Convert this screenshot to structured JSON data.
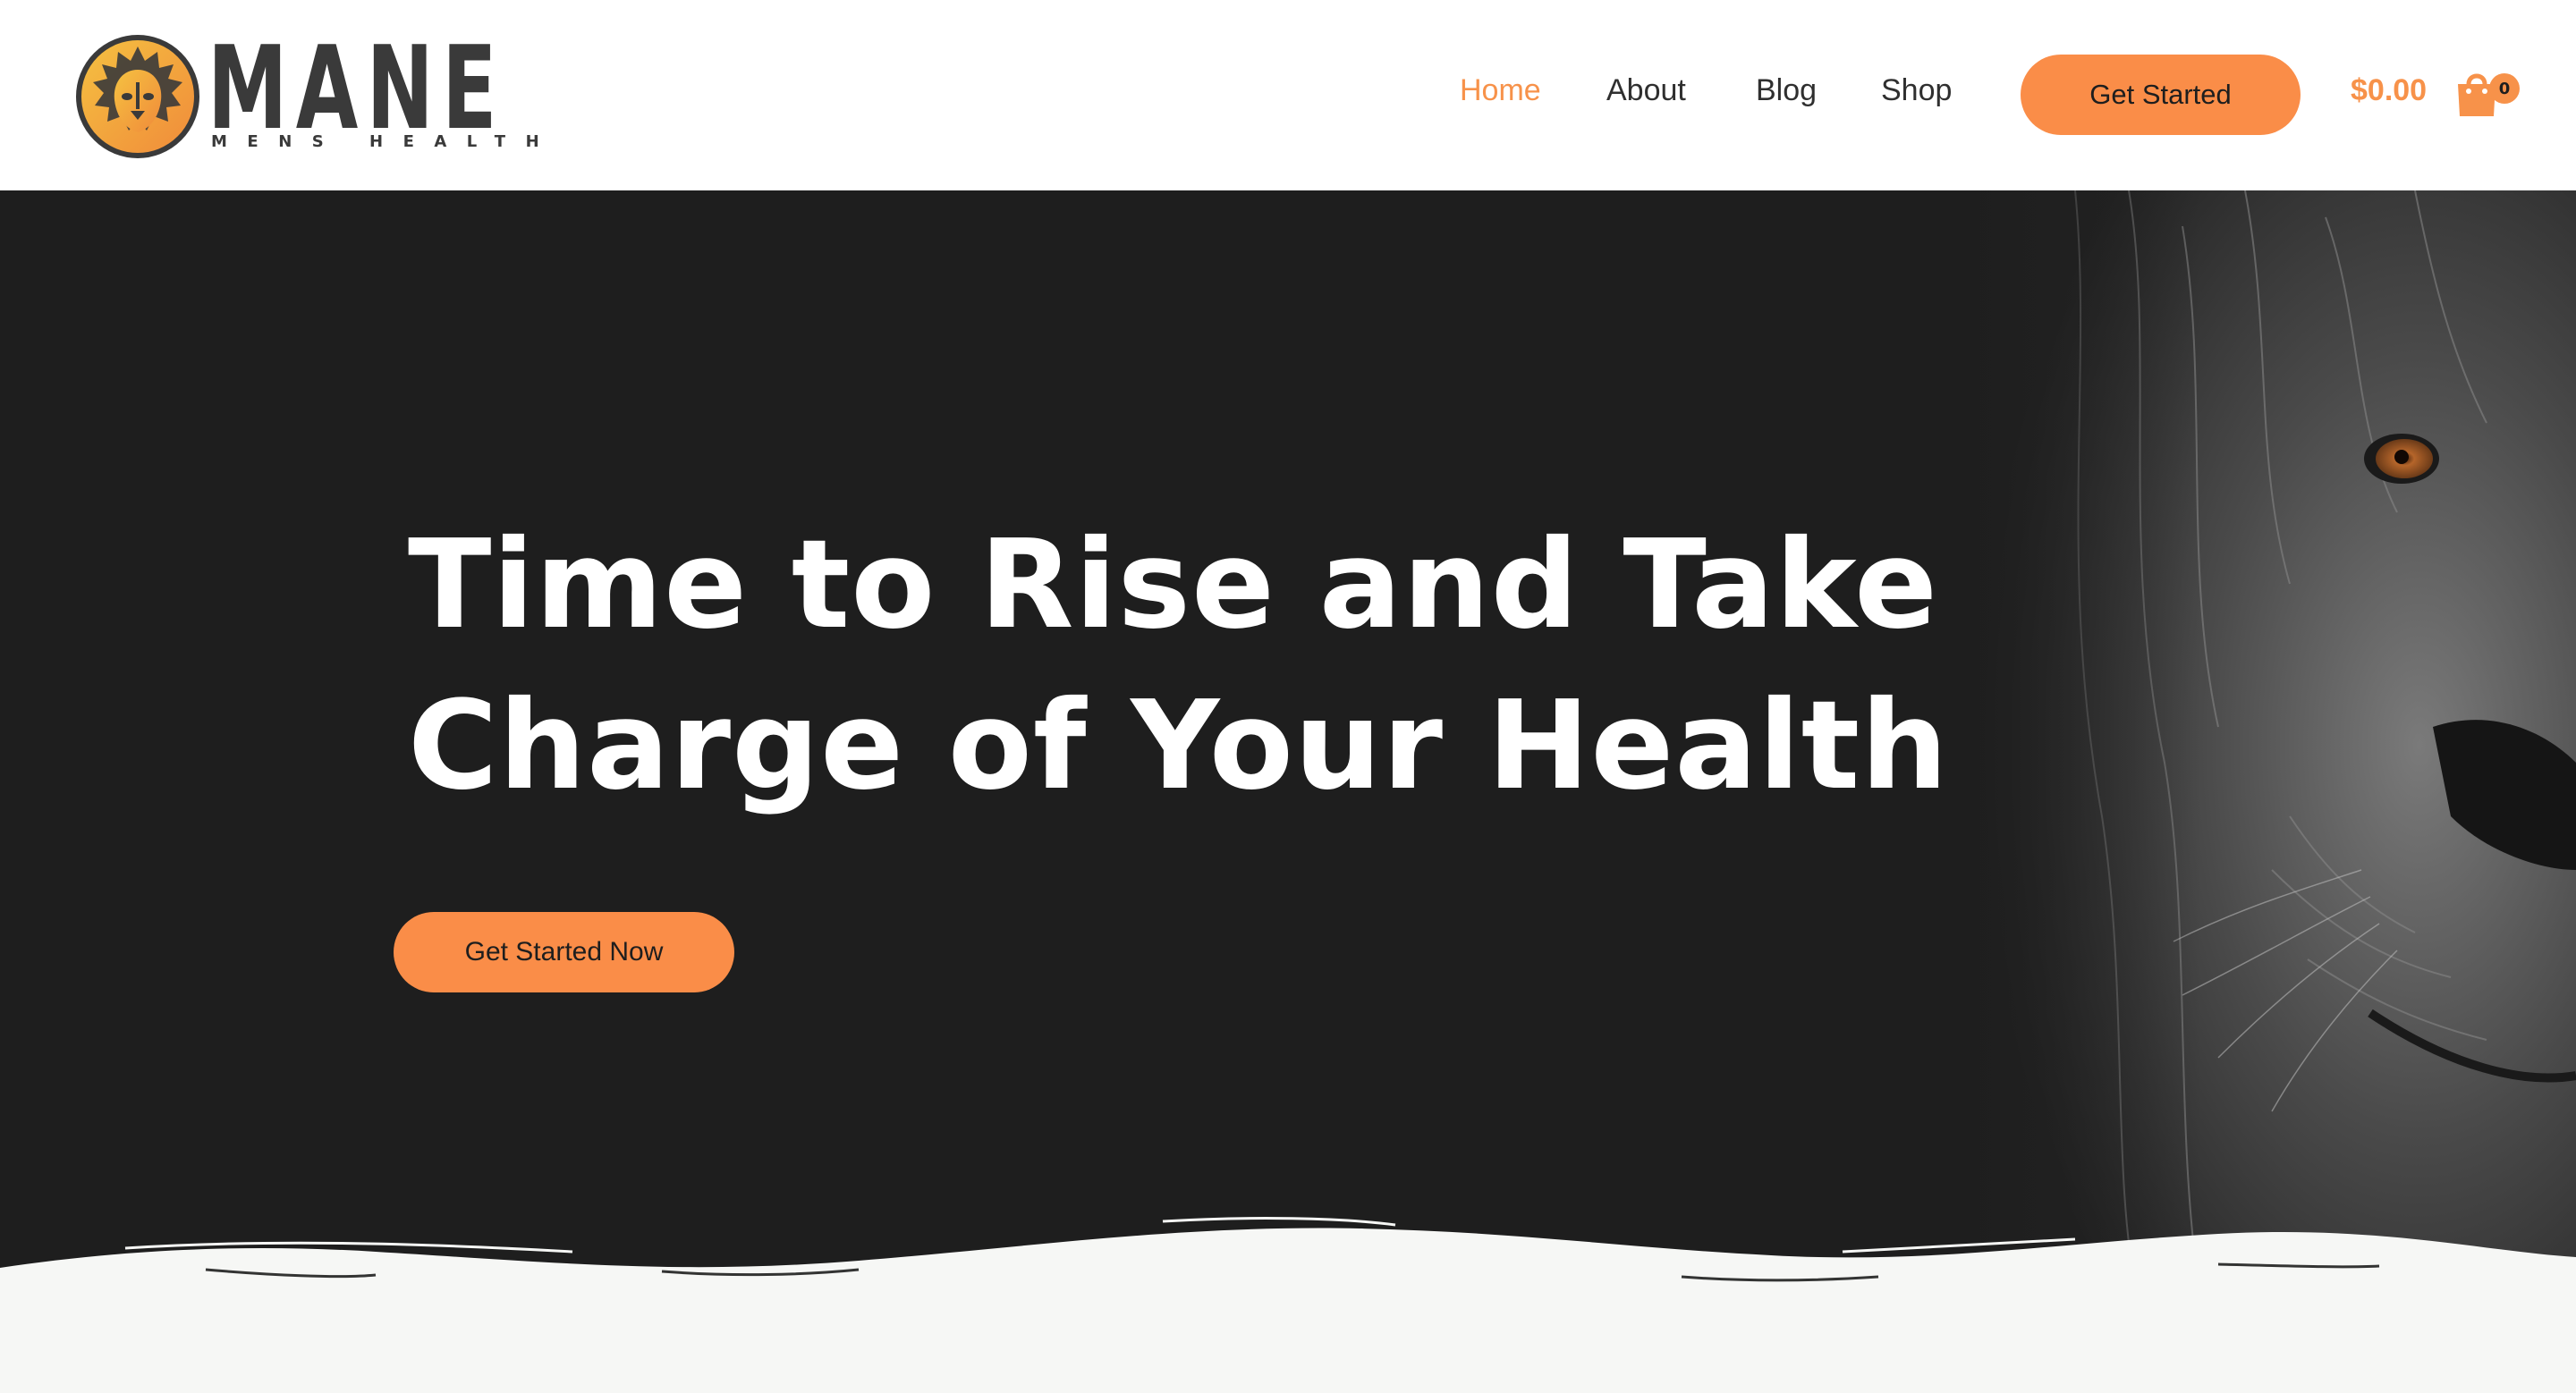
{
  "brand": {
    "name": "MANE",
    "tagline": "MENS HEALTH",
    "logo_icon": "lion-head-icon",
    "colors": {
      "accent": "#fa8d48",
      "dark": "#1e1e1e",
      "text": "#3a3a3a"
    }
  },
  "nav": {
    "items": [
      {
        "label": "Home",
        "active": true
      },
      {
        "label": "About",
        "active": false
      },
      {
        "label": "Blog",
        "active": false
      },
      {
        "label": "Shop",
        "active": false
      }
    ]
  },
  "header": {
    "cta_label": "Get Started",
    "cart_total": "$0.00",
    "cart_count": "0",
    "cart_icon": "shopping-bag-icon"
  },
  "hero": {
    "title_line1": "Time to Rise and Take",
    "title_line2": "Charge of Your Health",
    "cta_label": "Get Started Now",
    "image": "lion-face-photo"
  }
}
